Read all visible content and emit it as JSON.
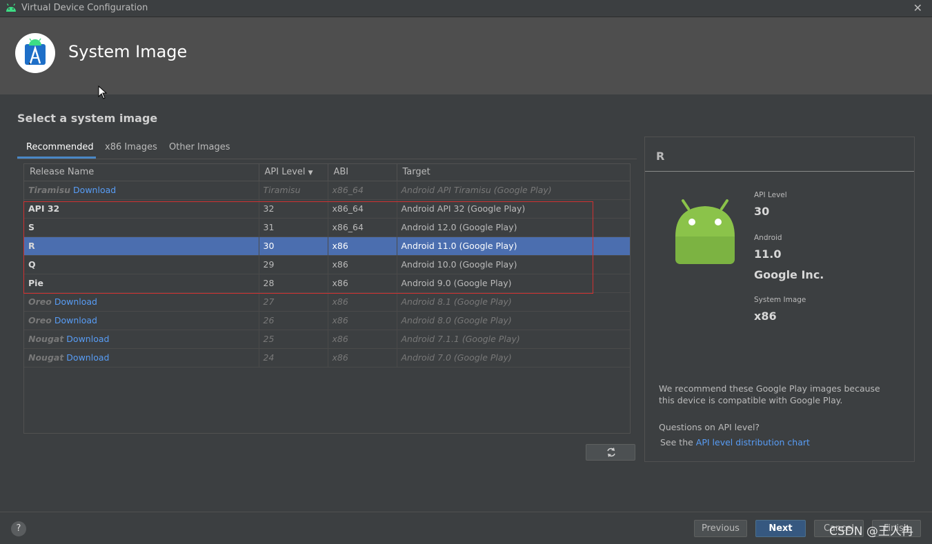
{
  "window": {
    "title": "Virtual Device Configuration",
    "close_glyph": "✕"
  },
  "header": {
    "title": "System Image"
  },
  "section_title": "Select a system image",
  "tabs": [
    {
      "label": "Recommended",
      "active": true
    },
    {
      "label": "x86 Images",
      "active": false
    },
    {
      "label": "Other Images",
      "active": false
    }
  ],
  "table": {
    "columns": [
      "Release Name",
      "API Level",
      "ABI",
      "Target"
    ],
    "sort_indicator": "▼",
    "rows": [
      {
        "release": "Tiramisu",
        "download": "Download",
        "api": "Tiramisu",
        "abi": "x86_64",
        "target": "Android API Tiramisu (Google Play)"
      },
      {
        "release": "API 32",
        "download": "",
        "api": "32",
        "abi": "x86_64",
        "target": "Android API 32 (Google Play)"
      },
      {
        "release": "S",
        "download": "",
        "api": "31",
        "abi": "x86_64",
        "target": "Android 12.0 (Google Play)"
      },
      {
        "release": "R",
        "download": "",
        "api": "30",
        "abi": "x86",
        "target": "Android 11.0 (Google Play)"
      },
      {
        "release": "Q",
        "download": "",
        "api": "29",
        "abi": "x86",
        "target": "Android 10.0 (Google Play)"
      },
      {
        "release": "Pie",
        "download": "",
        "api": "28",
        "abi": "x86",
        "target": "Android 9.0 (Google Play)"
      },
      {
        "release": "Oreo",
        "download": "Download",
        "api": "27",
        "abi": "x86",
        "target": "Android 8.1 (Google Play)"
      },
      {
        "release": "Oreo",
        "download": "Download",
        "api": "26",
        "abi": "x86",
        "target": "Android 8.0 (Google Play)"
      },
      {
        "release": "Nougat",
        "download": "Download",
        "api": "25",
        "abi": "x86",
        "target": "Android 7.1.1 (Google Play)"
      },
      {
        "release": "Nougat",
        "download": "Download",
        "api": "24",
        "abi": "x86",
        "target": "Android 7.0 (Google Play)"
      }
    ],
    "selected_index": 3
  },
  "details": {
    "title": "R",
    "api_level_label": "API Level",
    "api_level": "30",
    "android_label": "Android",
    "android_version": "11.0",
    "vendor": "Google Inc.",
    "system_image_label": "System Image",
    "system_image": "x86",
    "recommend_note": "We recommend these Google Play images because this device is compatible with Google Play.",
    "api_question": "Questions on API level?",
    "see_the": "See the ",
    "chart_link": "API level distribution chart"
  },
  "footer": {
    "help": "?",
    "previous": "Previous",
    "next": "Next",
    "cancel": "Cancel",
    "finish": "Finish",
    "watermark": "CSDN @王人冉"
  },
  "colors": {
    "selection": "#4b6eaf",
    "link": "#589df6",
    "highlight_box": "#d13131",
    "android_green": "#8bc34a"
  }
}
